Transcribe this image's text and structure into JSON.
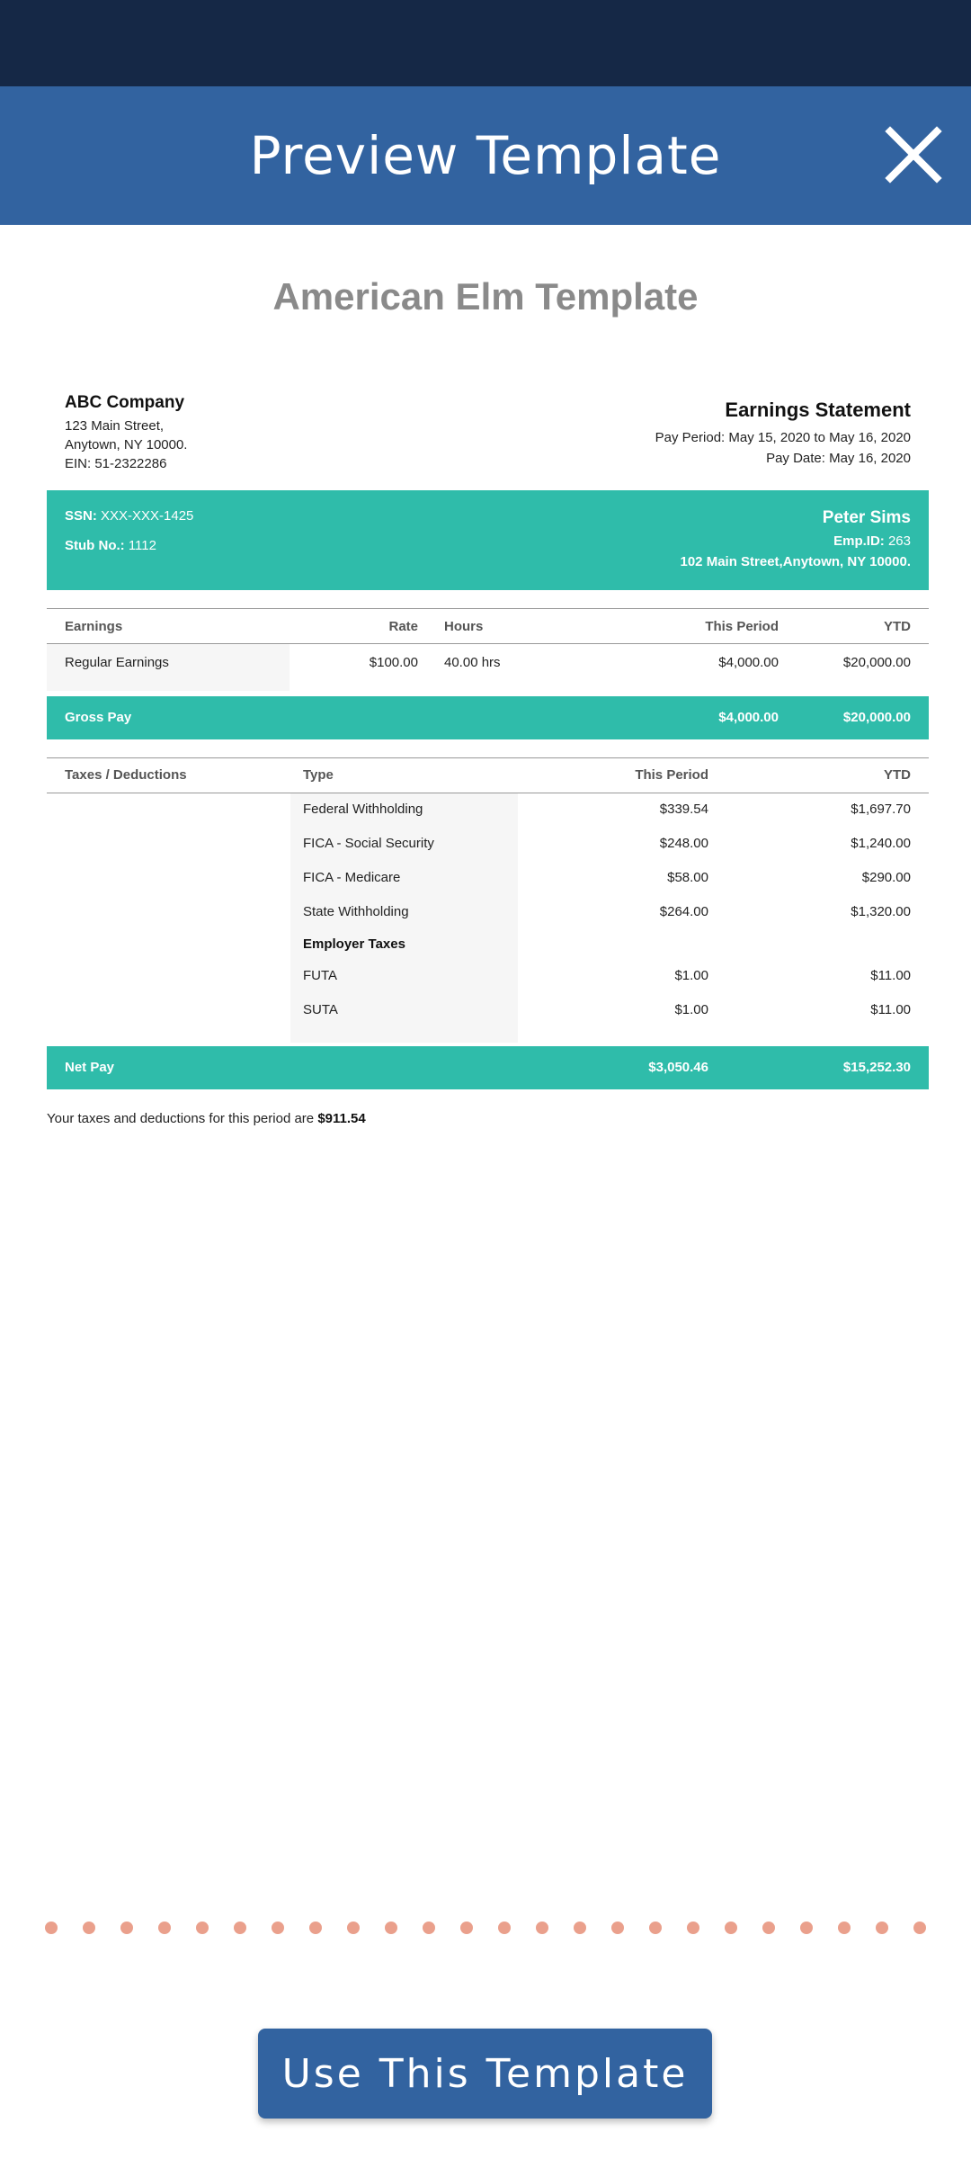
{
  "header": {
    "title": "Preview Template"
  },
  "template_name": "American Elm Template",
  "company": {
    "name": "ABC Company",
    "address1": "123 Main Street,",
    "address2": "Anytown, NY 10000.",
    "ein": "EIN: 51-2322286"
  },
  "statement": {
    "title": "Earnings Statement",
    "pay_period": "Pay Period: May 15, 2020 to May 16, 2020",
    "pay_date": "Pay Date: May 16, 2020"
  },
  "employee": {
    "ssn_label": "SSN:",
    "ssn": "XXX-XXX-1425",
    "stub_label": "Stub No.:",
    "stub": "1112",
    "name": "Peter Sims",
    "emp_id_label": "Emp.ID:",
    "emp_id": "263",
    "address": "102 Main Street,Anytown, NY 10000."
  },
  "earnings": {
    "headers": {
      "earnings": "Earnings",
      "rate": "Rate",
      "hours": "Hours",
      "this_period": "This Period",
      "ytd": "YTD"
    },
    "row": {
      "name": "Regular Earnings",
      "rate": "$100.00",
      "hours": "40.00 hrs",
      "this_period": "$4,000.00",
      "ytd": "$20,000.00"
    }
  },
  "gross_pay": {
    "label": "Gross Pay",
    "this_period": "$4,000.00",
    "ytd": "$20,000.00"
  },
  "taxes": {
    "headers": {
      "taxes": "Taxes / Deductions",
      "type": "Type",
      "this_period": "This Period",
      "ytd": "YTD"
    },
    "rows": [
      {
        "type": "Federal Withholding",
        "this_period": "$339.54",
        "ytd": "$1,697.70"
      },
      {
        "type": "FICA - Social Security",
        "this_period": "$248.00",
        "ytd": "$1,240.00"
      },
      {
        "type": "FICA - Medicare",
        "this_period": "$58.00",
        "ytd": "$290.00"
      },
      {
        "type": "State Withholding",
        "this_period": "$264.00",
        "ytd": "$1,320.00"
      }
    ],
    "employer_heading": "Employer Taxes",
    "employer_rows": [
      {
        "type": "FUTA",
        "this_period": "$1.00",
        "ytd": "$11.00"
      },
      {
        "type": "SUTA",
        "this_period": "$1.00",
        "ytd": "$11.00"
      }
    ]
  },
  "net_pay": {
    "label": "Net Pay",
    "this_period": "$3,050.46",
    "ytd": "$15,252.30"
  },
  "summary": {
    "text": "Your taxes and deductions for this period are",
    "amount": "$911.54"
  },
  "cta": {
    "label": "Use This Template"
  },
  "colors": {
    "header": "#3263a0",
    "status_bar": "#152846",
    "teal": "#2fbcaa",
    "dots": "#eaa08c"
  }
}
